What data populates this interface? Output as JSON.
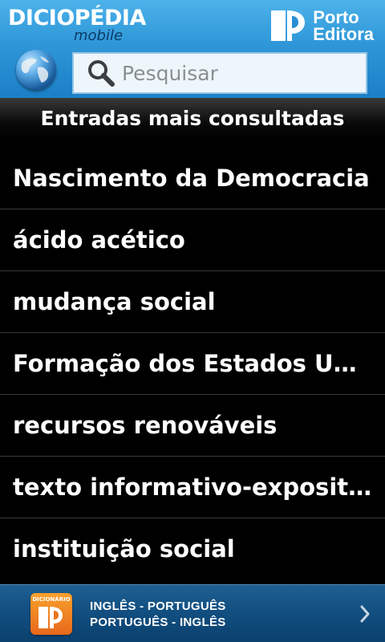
{
  "header": {
    "brand_name": "DICIOPÉDIA",
    "brand_sub": "mobile",
    "publisher_line1": "Porto",
    "publisher_line2": "Editora"
  },
  "search": {
    "placeholder": "Pesquisar"
  },
  "section": {
    "title": "Entradas mais consultadas"
  },
  "list": {
    "items": [
      {
        "label": "Nascimento da Democracia"
      },
      {
        "label": "ácido acético"
      },
      {
        "label": "mudança social"
      },
      {
        "label": "Formação dos Estados Unidos"
      },
      {
        "label": "recursos renováveis"
      },
      {
        "label": "texto informativo-expositivo"
      },
      {
        "label": "instituição social"
      }
    ]
  },
  "footer": {
    "icon_label": "DICIONÁRIO",
    "line1": "INGLÊS - PORTUGUÊS",
    "line2": "PORTUGUÊS - INGLÊS"
  },
  "icons": {
    "globe": "globe-icon",
    "search": "search-icon",
    "publisher": "porto-editora-logo-icon",
    "dictionary": "dictionary-app-icon",
    "chevron": "chevron-right-icon"
  }
}
